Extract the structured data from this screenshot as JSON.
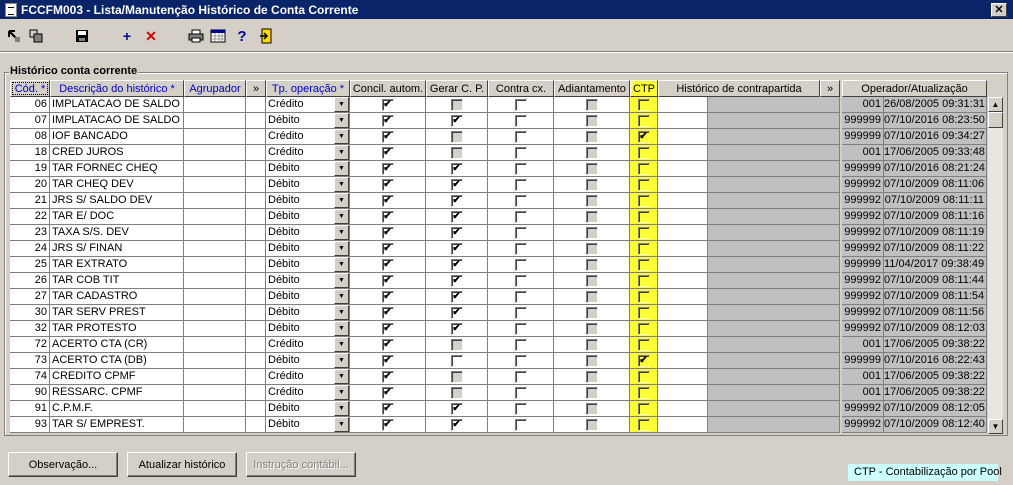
{
  "window": {
    "title": "FCCFM003 - Lista/Manutenção Histórico de Conta Corrente",
    "close_label": "✕"
  },
  "toolbar": {
    "icons": [
      "enter-query-icon",
      "execute-query-icon",
      "save-icon",
      "add-icon",
      "delete-icon",
      "print-icon",
      "calendar-icon",
      "help-icon",
      "exit-icon"
    ]
  },
  "group_title": "Histórico conta corrente",
  "headers": {
    "cod": "Cód. *",
    "descricao": "Descrição do histórico *",
    "agrupador": "Agrupador",
    "more1": "»",
    "tp_operacao": "Tp. operação *",
    "concil": "Concil. autom.",
    "gerar": "Gerar C. P.",
    "contra": "Contra cx.",
    "adiant": "Adiantamento",
    "ctp": "CTP",
    "hist_contra": "Histórico de contrapartida",
    "more2": "»",
    "operador": "Operador/Atualização"
  },
  "rows": [
    {
      "cod": "06",
      "desc": "IMPLATACAO DE SALDO (",
      "tipo": "Crédito",
      "concil": true,
      "gerar": false,
      "gerar_dis": true,
      "contra": false,
      "adiant": false,
      "adiant_dis": true,
      "ctp": false,
      "op": "001",
      "data": "26/08/2005 09:31:31"
    },
    {
      "cod": "07",
      "desc": "IMPLATACAO DE SALDO (",
      "tipo": "Débito",
      "concil": true,
      "gerar": true,
      "gerar_dis": false,
      "contra": false,
      "adiant": false,
      "adiant_dis": true,
      "ctp": false,
      "op": "999999",
      "data": "07/10/2016 08:23:50"
    },
    {
      "cod": "08",
      "desc": "IOF BANCADO",
      "tipo": "Crédito",
      "concil": true,
      "gerar": false,
      "gerar_dis": true,
      "contra": false,
      "adiant": false,
      "adiant_dis": true,
      "ctp": true,
      "op": "999999",
      "data": "07/10/2016 09:34:27"
    },
    {
      "cod": "18",
      "desc": "CRED JUROS",
      "tipo": "Crédito",
      "concil": true,
      "gerar": false,
      "gerar_dis": true,
      "contra": false,
      "adiant": false,
      "adiant_dis": true,
      "ctp": false,
      "op": "001",
      "data": "17/06/2005 09:33:48"
    },
    {
      "cod": "19",
      "desc": "TAR FORNEC CHEQ",
      "tipo": "Débito",
      "concil": true,
      "gerar": true,
      "gerar_dis": false,
      "contra": false,
      "adiant": false,
      "adiant_dis": true,
      "ctp": false,
      "op": "999999",
      "data": "07/10/2016 08:21:24"
    },
    {
      "cod": "20",
      "desc": "TAR CHEQ DEV",
      "tipo": "Débito",
      "concil": true,
      "gerar": true,
      "gerar_dis": false,
      "contra": false,
      "adiant": false,
      "adiant_dis": true,
      "ctp": false,
      "op": "999992",
      "data": "07/10/2009 08:11:06"
    },
    {
      "cod": "21",
      "desc": "JRS S/ SALDO DEV",
      "tipo": "Débito",
      "concil": true,
      "gerar": true,
      "gerar_dis": false,
      "contra": false,
      "adiant": false,
      "adiant_dis": true,
      "ctp": false,
      "op": "999992",
      "data": "07/10/2009 08:11:11"
    },
    {
      "cod": "22",
      "desc": "TAR E/ DOC",
      "tipo": "Débito",
      "concil": true,
      "gerar": true,
      "gerar_dis": false,
      "contra": false,
      "adiant": false,
      "adiant_dis": true,
      "ctp": false,
      "op": "999992",
      "data": "07/10/2009 08:11:16"
    },
    {
      "cod": "23",
      "desc": "TAXA S/S. DEV",
      "tipo": "Débito",
      "concil": true,
      "gerar": true,
      "gerar_dis": false,
      "contra": false,
      "adiant": false,
      "adiant_dis": true,
      "ctp": false,
      "op": "999992",
      "data": "07/10/2009 08:11:19"
    },
    {
      "cod": "24",
      "desc": "JRS S/ FINAN",
      "tipo": "Débito",
      "concil": true,
      "gerar": true,
      "gerar_dis": false,
      "contra": false,
      "adiant": false,
      "adiant_dis": true,
      "ctp": false,
      "op": "999992",
      "data": "07/10/2009 08:11:22"
    },
    {
      "cod": "25",
      "desc": "TAR EXTRATO",
      "tipo": "Débito",
      "concil": true,
      "gerar": true,
      "gerar_dis": false,
      "contra": false,
      "adiant": false,
      "adiant_dis": true,
      "ctp": false,
      "op": "999999",
      "data": "11/04/2017 09:38:49"
    },
    {
      "cod": "26",
      "desc": "TAR COB TIT",
      "tipo": "Débito",
      "concil": true,
      "gerar": true,
      "gerar_dis": false,
      "contra": false,
      "adiant": false,
      "adiant_dis": true,
      "ctp": false,
      "op": "999992",
      "data": "07/10/2009 08:11:44"
    },
    {
      "cod": "27",
      "desc": "TAR CADASTRO",
      "tipo": "Débito",
      "concil": true,
      "gerar": true,
      "gerar_dis": false,
      "contra": false,
      "adiant": false,
      "adiant_dis": true,
      "ctp": false,
      "op": "999992",
      "data": "07/10/2009 08:11:54"
    },
    {
      "cod": "30",
      "desc": "TAR SERV PREST",
      "tipo": "Débito",
      "concil": true,
      "gerar": true,
      "gerar_dis": false,
      "contra": false,
      "adiant": false,
      "adiant_dis": true,
      "ctp": false,
      "op": "999992",
      "data": "07/10/2009 08:11:56"
    },
    {
      "cod": "32",
      "desc": "TAR PROTESTO",
      "tipo": "Débito",
      "concil": true,
      "gerar": true,
      "gerar_dis": false,
      "contra": false,
      "adiant": false,
      "adiant_dis": true,
      "ctp": false,
      "op": "999992",
      "data": "07/10/2009 08:12:03"
    },
    {
      "cod": "72",
      "desc": "ACERTO CTA (CR)",
      "tipo": "Crédito",
      "concil": true,
      "gerar": false,
      "gerar_dis": true,
      "contra": false,
      "adiant": false,
      "adiant_dis": true,
      "ctp": false,
      "op": "001",
      "data": "17/06/2005 09:38:22"
    },
    {
      "cod": "73",
      "desc": "ACERTO CTA (DB)",
      "tipo": "Débito",
      "concil": true,
      "gerar": false,
      "gerar_dis": false,
      "contra": false,
      "adiant": false,
      "adiant_dis": true,
      "ctp": true,
      "op": "999999",
      "data": "07/10/2016 08:22:43"
    },
    {
      "cod": "74",
      "desc": "CREDITO CPMF",
      "tipo": "Crédito",
      "concil": true,
      "gerar": false,
      "gerar_dis": true,
      "contra": false,
      "adiant": false,
      "adiant_dis": true,
      "ctp": false,
      "op": "001",
      "data": "17/06/2005 09:38:22"
    },
    {
      "cod": "90",
      "desc": "RESSARC. CPMF",
      "tipo": "Crédito",
      "concil": true,
      "gerar": false,
      "gerar_dis": true,
      "contra": false,
      "adiant": false,
      "adiant_dis": true,
      "ctp": false,
      "op": "001",
      "data": "17/06/2005 09:38:22"
    },
    {
      "cod": "91",
      "desc": "C.P.M.F.",
      "tipo": "Débito",
      "concil": true,
      "gerar": true,
      "gerar_dis": false,
      "contra": false,
      "adiant": false,
      "adiant_dis": true,
      "ctp": false,
      "op": "999992",
      "data": "07/10/2009 08:12:05"
    },
    {
      "cod": "93",
      "desc": "TAR S/ EMPREST.",
      "tipo": "Débito",
      "concil": true,
      "gerar": true,
      "gerar_dis": false,
      "contra": false,
      "adiant": false,
      "adiant_dis": true,
      "ctp": false,
      "op": "999992",
      "data": "07/10/2009 08:12:40"
    }
  ],
  "buttons": {
    "observacao": "Observação...",
    "atualizar": "Atualizar histórico",
    "instrucao": "Instrução contábil..."
  },
  "legend": "CTP - Contabilização por Pool",
  "colors": {
    "titlebar": "#0a246a",
    "ctp_highlight": "#ffff33",
    "legend_bg": "#ccffff",
    "header_blue": "#0000cc"
  }
}
